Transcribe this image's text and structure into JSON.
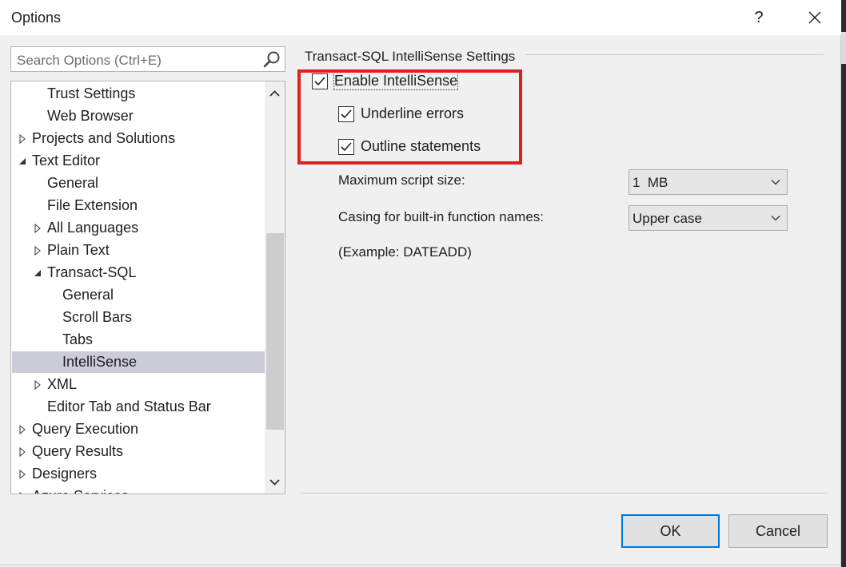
{
  "window": {
    "title": "Options",
    "help_label": "?",
    "close_icon": "close-icon"
  },
  "search": {
    "placeholder": "Search Options (Ctrl+E)",
    "icon": "search-icon"
  },
  "tree": {
    "items": [
      {
        "label": "Trust Settings",
        "level": 1,
        "expander": "none"
      },
      {
        "label": "Web Browser",
        "level": 1,
        "expander": "none"
      },
      {
        "label": "Projects and Solutions",
        "level": 0,
        "expander": "collapsed"
      },
      {
        "label": "Text Editor",
        "level": 0,
        "expander": "expanded"
      },
      {
        "label": "General",
        "level": 1,
        "expander": "none"
      },
      {
        "label": "File Extension",
        "level": 1,
        "expander": "none"
      },
      {
        "label": "All Languages",
        "level": 1,
        "expander": "collapsed"
      },
      {
        "label": "Plain Text",
        "level": 1,
        "expander": "collapsed"
      },
      {
        "label": "Transact-SQL",
        "level": 1,
        "expander": "expanded"
      },
      {
        "label": "General",
        "level": 2,
        "expander": "none"
      },
      {
        "label": "Scroll Bars",
        "level": 2,
        "expander": "none"
      },
      {
        "label": "Tabs",
        "level": 2,
        "expander": "none"
      },
      {
        "label": "IntelliSense",
        "level": 2,
        "expander": "none",
        "selected": true
      },
      {
        "label": "XML",
        "level": 1,
        "expander": "collapsed"
      },
      {
        "label": "Editor Tab and Status Bar",
        "level": 1,
        "expander": "none"
      },
      {
        "label": "Query Execution",
        "level": 0,
        "expander": "collapsed"
      },
      {
        "label": "Query Results",
        "level": 0,
        "expander": "collapsed"
      },
      {
        "label": "Designers",
        "level": 0,
        "expander": "collapsed"
      },
      {
        "label": "Azure Services",
        "level": 0,
        "expander": "collapsed"
      }
    ]
  },
  "settings": {
    "section_title": "Transact-SQL IntelliSense Settings",
    "enable_intellisense": {
      "label": "Enable IntelliSense",
      "checked": true
    },
    "underline_errors": {
      "label": "Underline errors",
      "checked": true
    },
    "outline_statements": {
      "label": "Outline statements",
      "checked": true
    },
    "max_script_size": {
      "label": "Maximum script size:",
      "value": "1  MB"
    },
    "casing": {
      "label": "Casing for built-in function names:",
      "value": "Upper case"
    },
    "example": "(Example: DATEADD)"
  },
  "buttons": {
    "ok": "OK",
    "cancel": "Cancel"
  },
  "colors": {
    "highlight": "#e0201f",
    "selection": "#ccccd9",
    "default_button_border": "#0078d7"
  }
}
